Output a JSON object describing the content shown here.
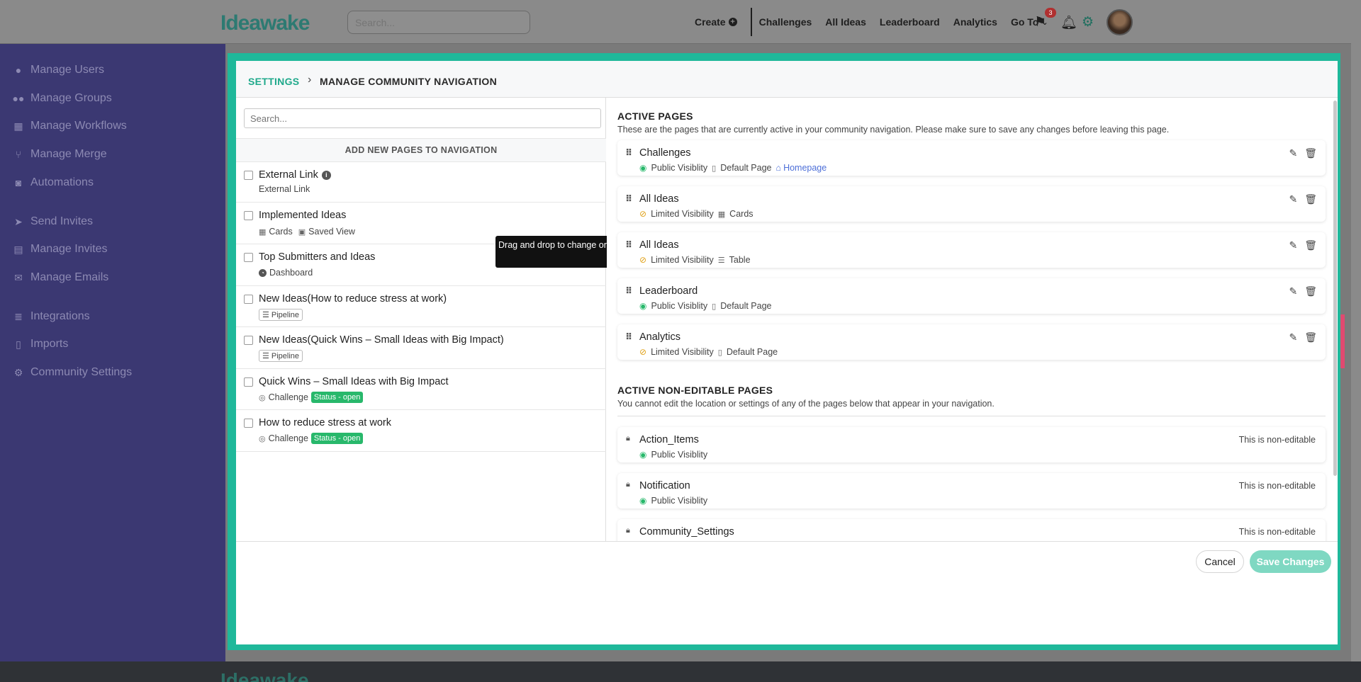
{
  "topbar": {
    "logo": "Ideawake",
    "search_placeholder": "Search...",
    "nav": {
      "create": "Create",
      "challenges": "Challenges",
      "all_ideas": "All Ideas",
      "leaderboard": "Leaderboard",
      "analytics": "Analytics",
      "go_to": "Go To"
    },
    "notification_count": "3"
  },
  "sidebar": {
    "items": [
      {
        "label": "Manage Users",
        "icon": "user-icon"
      },
      {
        "label": "Manage Groups",
        "icon": "users-icon"
      },
      {
        "label": "Manage Workflows",
        "icon": "workflow-icon"
      },
      {
        "label": "Manage Merge",
        "icon": "merge-icon"
      },
      {
        "label": "Automations",
        "icon": "robot-icon"
      },
      {
        "label": "Send Invites",
        "icon": "paper-plane-icon"
      },
      {
        "label": "Manage Invites",
        "icon": "briefcase-icon"
      },
      {
        "label": "Manage Emails",
        "icon": "envelope-icon"
      },
      {
        "label": "Integrations",
        "icon": "database-icon"
      },
      {
        "label": "Imports",
        "icon": "file-icon"
      },
      {
        "label": "Community Settings",
        "icon": "gears-icon"
      }
    ]
  },
  "modal": {
    "breadcrumb_root": "SETTINGS",
    "breadcrumb_current": "MANAGE COMMUNITY NAVIGATION",
    "left": {
      "search_placeholder": "Search...",
      "header": "ADD NEW PAGES TO NAVIGATION",
      "items": [
        {
          "title": "External Link",
          "sub": "External Link"
        },
        {
          "title": "Implemented Ideas",
          "sub1": "Cards",
          "sub2": "Saved View"
        },
        {
          "title": "Top Submitters and Ideas",
          "sub": "Dashboard"
        },
        {
          "title": "New Ideas(How to reduce stress at work)",
          "tag": "Pipeline"
        },
        {
          "title": "New Ideas(Quick Wins – Small Ideas with Big Impact)",
          "tag": "Pipeline"
        },
        {
          "title": "Quick Wins – Small Ideas with Big Impact",
          "sub": "Challenge",
          "status": "Status - open"
        },
        {
          "title": "How to reduce stress at work",
          "sub": "Challenge",
          "status": "Status - open"
        }
      ]
    },
    "tooltip": "Drag and drop to change order",
    "active": {
      "heading": "ACTIVE PAGES",
      "description": "These are the pages that are currently active in your community navigation. Please make sure to save any changes before leaving this page.",
      "pages": [
        {
          "title": "Challenges",
          "visibility": "Public Visiblity",
          "type": "Default Page",
          "homepage": "Homepage"
        },
        {
          "title": "All Ideas",
          "visibility": "Limited Visibility",
          "type": "Cards"
        },
        {
          "title": "All Ideas",
          "visibility": "Limited Visibility",
          "type": "Table"
        },
        {
          "title": "Leaderboard",
          "visibility": "Public Visiblity",
          "type": "Default Page"
        },
        {
          "title": "Analytics",
          "visibility": "Limited Visibility",
          "type": "Default Page"
        }
      ]
    },
    "non_editable": {
      "heading": "ACTIVE NON-EDITABLE PAGES",
      "description": "You cannot edit the location or settings of any of the pages below that appear in your navigation.",
      "note": "This is non-editable",
      "pages": [
        {
          "title": "Action_Items",
          "visibility": "Public Visiblity"
        },
        {
          "title": "Notification",
          "visibility": "Public Visiblity"
        },
        {
          "title": "Community_Settings"
        }
      ]
    },
    "footer": {
      "cancel": "Cancel",
      "save": "Save Changes"
    }
  }
}
